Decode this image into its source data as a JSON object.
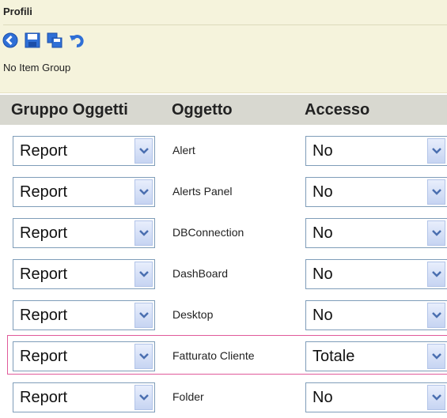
{
  "header": {
    "title": "Profili",
    "subtitle": "No Item Group"
  },
  "toolbar": {
    "buttons": [
      "back-icon",
      "save-icon",
      "save-as-icon",
      "undo-icon"
    ]
  },
  "table": {
    "columns": [
      "Gruppo Oggetti",
      "Oggetto",
      "Accesso"
    ],
    "rows": [
      {
        "group": "Report",
        "object": "Alert",
        "access": "No"
      },
      {
        "group": "Report",
        "object": "Alerts Panel",
        "access": "No"
      },
      {
        "group": "Report",
        "object": "DBConnection",
        "access": "No"
      },
      {
        "group": "Report",
        "object": "DashBoard",
        "access": "No"
      },
      {
        "group": "Report",
        "object": "Desktop",
        "access": "No"
      },
      {
        "group": "Report",
        "object": "Fatturato Cliente",
        "access": "Totale"
      },
      {
        "group": "Report",
        "object": "Folder",
        "access": "No"
      }
    ],
    "highlighted_row": 5
  },
  "colors": {
    "header_bg": "#f5f3dc",
    "table_header_bg": "#d8d8d0",
    "select_border": "#7f9db9",
    "highlight": "#e05a9a",
    "icon_blue": "#2f6fd6"
  }
}
